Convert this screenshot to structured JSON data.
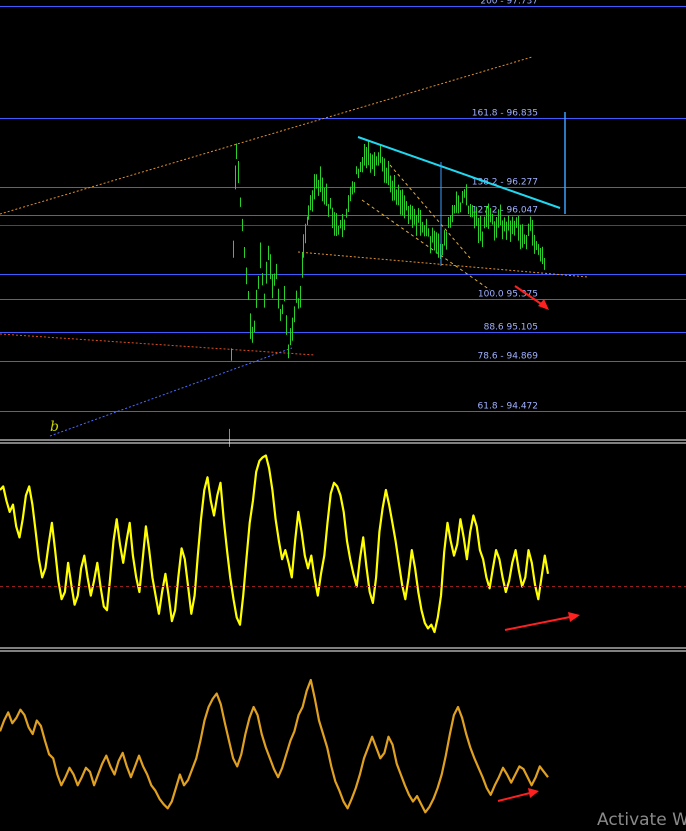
{
  "chart_data": [
    {
      "type": "bar",
      "panel": "price",
      "fib_levels": [
        {
          "label": "200 - 97.737",
          "value": 97.737
        },
        {
          "label": "161.8 -  96.835",
          "value": 96.835
        },
        {
          "label": "138.2 - 96.277",
          "value": 96.277
        },
        {
          "label": "",
          "value": 96.05
        },
        {
          "label": "",
          "value": 95.97
        },
        {
          "label": "",
          "value": 95.57
        },
        {
          "label": "100.0 95.375",
          "value": 95.375
        },
        {
          "label": "88.6 95.105",
          "value": 95.105
        },
        {
          "label": "78.6 - 94.869",
          "value": 94.869
        },
        {
          "label": "61.8 - 94.472",
          "value": 94.472
        }
      ],
      "range_label": "127.2 - 96.047",
      "wave_label": "b",
      "price_y_range": [
        94.3,
        97.75
      ],
      "trend_colors": {
        "bars": "#2bd12b",
        "fib": "#3f5bff",
        "trendline": "#20d8f0",
        "arrow": "#ff2020",
        "dashed": "#e09030"
      }
    },
    {
      "type": "line",
      "panel": "oscillator-1",
      "color": "#ffff00",
      "values": [
        0.78,
        0.8,
        0.72,
        0.66,
        0.7,
        0.58,
        0.52,
        0.62,
        0.75,
        0.8,
        0.7,
        0.55,
        0.4,
        0.3,
        0.35,
        0.48,
        0.6,
        0.45,
        0.28,
        0.18,
        0.22,
        0.38,
        0.26,
        0.15,
        0.2,
        0.35,
        0.42,
        0.3,
        0.2,
        0.28,
        0.38,
        0.25,
        0.14,
        0.12,
        0.3,
        0.5,
        0.62,
        0.48,
        0.38,
        0.5,
        0.6,
        0.42,
        0.3,
        0.22,
        0.4,
        0.58,
        0.45,
        0.3,
        0.2,
        0.1,
        0.22,
        0.32,
        0.2,
        0.06,
        0.12,
        0.3,
        0.46,
        0.4,
        0.25,
        0.1,
        0.2,
        0.42,
        0.62,
        0.78,
        0.85,
        0.72,
        0.64,
        0.75,
        0.82,
        0.62,
        0.45,
        0.3,
        0.18,
        0.08,
        0.04,
        0.2,
        0.4,
        0.6,
        0.72,
        0.88,
        0.94,
        0.96,
        0.97,
        0.9,
        0.78,
        0.62,
        0.5,
        0.4,
        0.45,
        0.38,
        0.3,
        0.5,
        0.66,
        0.55,
        0.42,
        0.35,
        0.42,
        0.3,
        0.2,
        0.32,
        0.42,
        0.6,
        0.76,
        0.82,
        0.8,
        0.75,
        0.66,
        0.5,
        0.4,
        0.32,
        0.25,
        0.4,
        0.52,
        0.36,
        0.22,
        0.16,
        0.3,
        0.55,
        0.68,
        0.78,
        0.7,
        0.6,
        0.5,
        0.38,
        0.26,
        0.18,
        0.3,
        0.45,
        0.35,
        0.22,
        0.12,
        0.05,
        0.02,
        0.04,
        0.0,
        0.08,
        0.2,
        0.44,
        0.6,
        0.5,
        0.42,
        0.48,
        0.62,
        0.52,
        0.4,
        0.55,
        0.64,
        0.58,
        0.45,
        0.4,
        0.3,
        0.24,
        0.35,
        0.45,
        0.4,
        0.3,
        0.22,
        0.28,
        0.38,
        0.45,
        0.34,
        0.25,
        0.3,
        0.45,
        0.38,
        0.26,
        0.18,
        0.3,
        0.42,
        0.32
      ],
      "baseline": 0.25,
      "y_range": [
        0,
        1
      ]
    },
    {
      "type": "line",
      "panel": "oscillator-2",
      "color": "#e0a020",
      "values": [
        0.62,
        0.7,
        0.76,
        0.68,
        0.72,
        0.78,
        0.74,
        0.65,
        0.6,
        0.7,
        0.66,
        0.55,
        0.45,
        0.42,
        0.3,
        0.22,
        0.28,
        0.35,
        0.3,
        0.22,
        0.28,
        0.35,
        0.32,
        0.22,
        0.3,
        0.38,
        0.44,
        0.36,
        0.3,
        0.4,
        0.46,
        0.36,
        0.28,
        0.36,
        0.44,
        0.36,
        0.3,
        0.22,
        0.18,
        0.12,
        0.08,
        0.05,
        0.1,
        0.2,
        0.3,
        0.22,
        0.26,
        0.34,
        0.42,
        0.55,
        0.7,
        0.8,
        0.86,
        0.9,
        0.82,
        0.68,
        0.55,
        0.42,
        0.36,
        0.45,
        0.6,
        0.72,
        0.8,
        0.74,
        0.6,
        0.5,
        0.42,
        0.34,
        0.28,
        0.35,
        0.45,
        0.55,
        0.62,
        0.74,
        0.8,
        0.92,
        1.0,
        0.86,
        0.7,
        0.6,
        0.5,
        0.36,
        0.25,
        0.18,
        0.1,
        0.05,
        0.12,
        0.2,
        0.3,
        0.42,
        0.5,
        0.58,
        0.5,
        0.42,
        0.46,
        0.58,
        0.52,
        0.38,
        0.3,
        0.22,
        0.15,
        0.1,
        0.14,
        0.08,
        0.02,
        0.06,
        0.12,
        0.2,
        0.3,
        0.44,
        0.6,
        0.74,
        0.8,
        0.72,
        0.6,
        0.5,
        0.42,
        0.35,
        0.28,
        0.2,
        0.15,
        0.22,
        0.28,
        0.35,
        0.3,
        0.24,
        0.3,
        0.36,
        0.34,
        0.28,
        0.22,
        0.28,
        0.36,
        0.32,
        0.28
      ],
      "y_range": [
        0,
        1
      ]
    }
  ],
  "watermark": "Activate W"
}
